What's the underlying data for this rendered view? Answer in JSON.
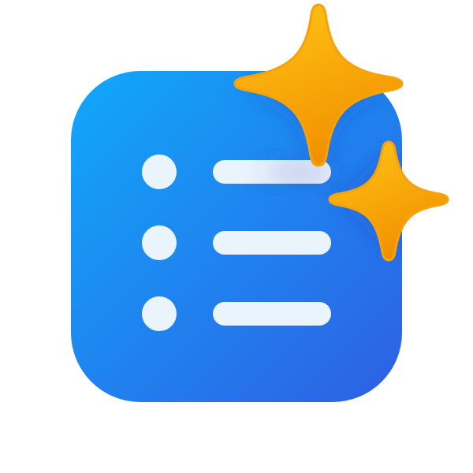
{
  "icon": {
    "name": "list-with-sparkles-icon",
    "list_rows": 3,
    "sparkles": 2
  },
  "colors": {
    "tile_gradient_start": "#10A8FB",
    "tile_gradient_end": "#2E5FE3",
    "list_item": "#EAF4FD",
    "sparkle_gradient_start": "#FFC617",
    "sparkle_gradient_end": "#F29100",
    "sparkle_glow": "#2B2F9E",
    "background": "#FFFFFF"
  }
}
